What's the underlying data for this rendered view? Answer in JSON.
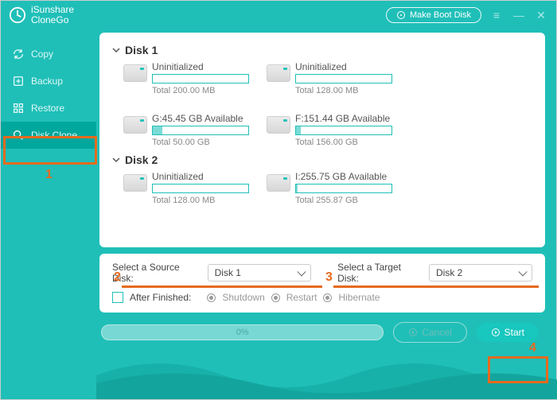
{
  "app": {
    "title1": "iSunshare",
    "title2": "CloneGo",
    "make_boot": "Make Boot Disk"
  },
  "nav": {
    "items": [
      {
        "label": "Copy"
      },
      {
        "label": "Backup"
      },
      {
        "label": "Restore"
      },
      {
        "label": "Disk Clone"
      }
    ]
  },
  "disks": [
    {
      "name": "Disk 1",
      "partitions": [
        {
          "label": "Uninitialized",
          "total": "Total 200.00 MB",
          "fill": 0
        },
        {
          "label": "Uninitialized",
          "total": "Total 128.00 MB",
          "fill": 0
        },
        {
          "label": "G:45.45 GB Available",
          "total": "Total 50.00 GB",
          "fill": 10
        },
        {
          "label": "F:151.44 GB Available",
          "total": "Total 156.00 GB",
          "fill": 5
        }
      ]
    },
    {
      "name": "Disk 2",
      "partitions": [
        {
          "label": "Uninitialized",
          "total": "Total 128.00 MB",
          "fill": 0
        },
        {
          "label": "I:255.75 GB Available",
          "total": "Total 255.87 GB",
          "fill": 2
        }
      ]
    }
  ],
  "options": {
    "source_label": "Select a Source Disk:",
    "source_value": "Disk 1",
    "target_label": "Select a Target Disk:",
    "target_value": "Disk 2",
    "after_checkbox_label": "After Finished:",
    "radios": {
      "shutdown": "Shutdown",
      "restart": "Restart",
      "hibernate": "Hibernate"
    }
  },
  "footer": {
    "progress": "0%",
    "cancel": "Cancel",
    "start": "Start"
  },
  "annotations": {
    "n1": "1",
    "n2": "2",
    "n3": "3",
    "n4": "4"
  }
}
